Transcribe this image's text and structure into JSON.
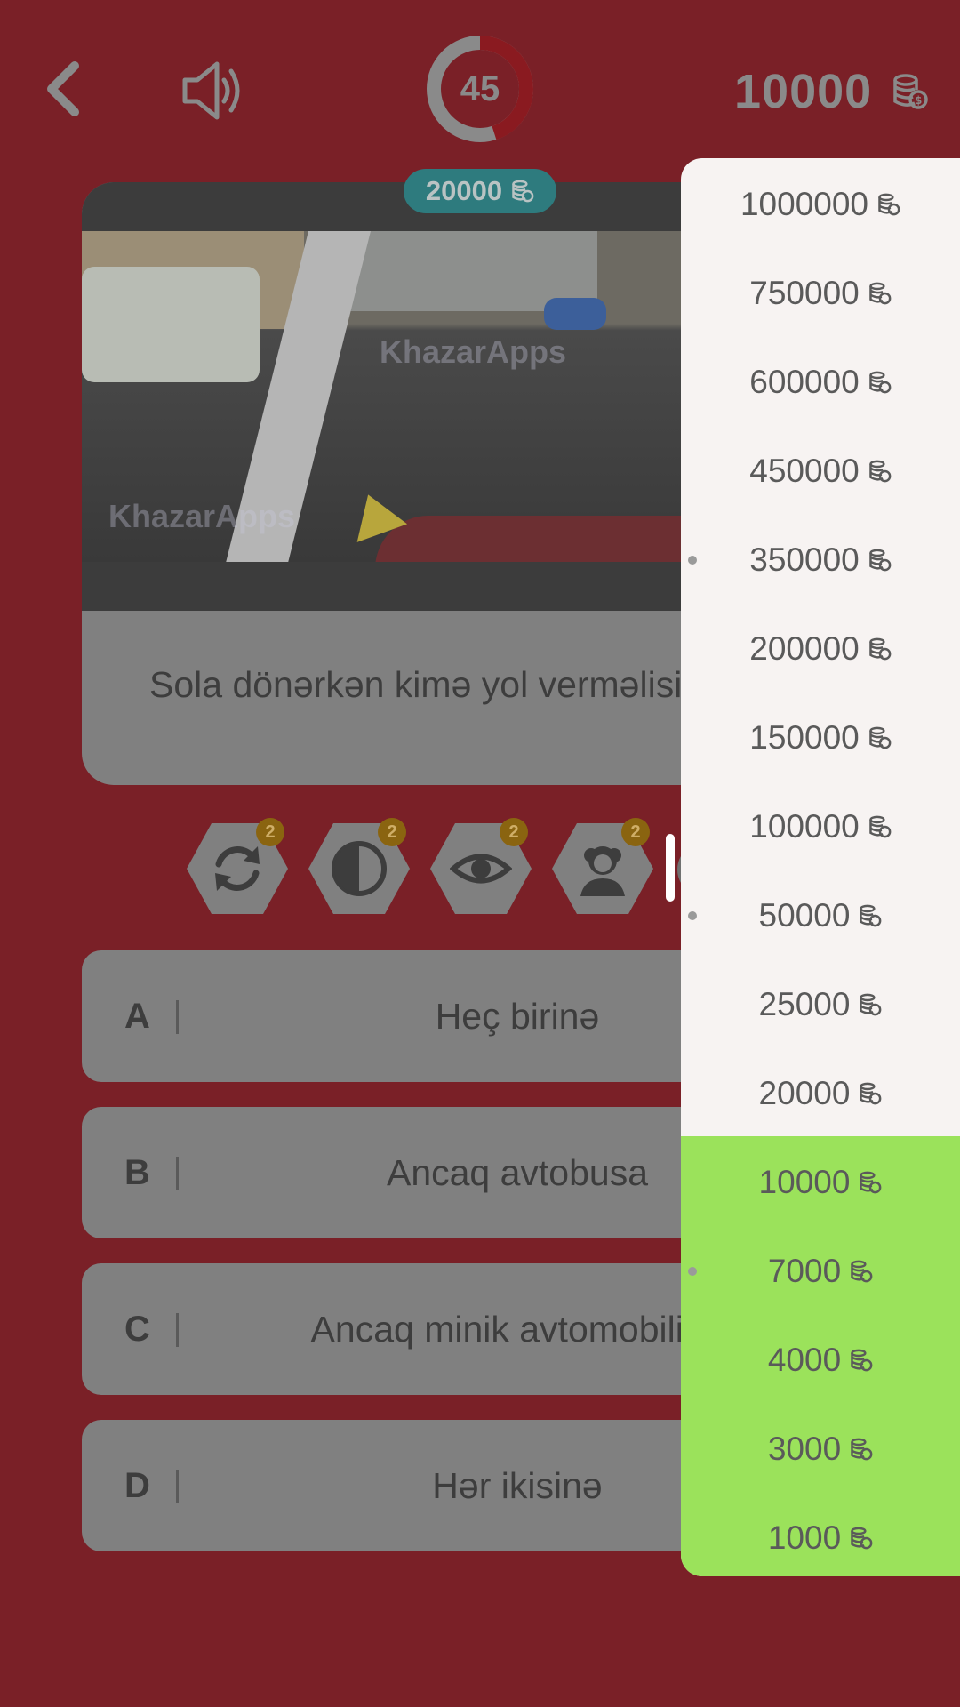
{
  "header": {
    "timer_value": "45",
    "timer_progress": 0.45,
    "balance": "10000",
    "icons": [
      "back-arrow-icon",
      "speaker-icon",
      "coins-icon"
    ]
  },
  "question": {
    "reward": "20000",
    "text": "Sola dönərkən kimə yol verməlisiniz?",
    "watermark": "KhazarApps"
  },
  "lifelines": [
    {
      "name": "swap-question",
      "icon": "refresh-icon",
      "count": "2"
    },
    {
      "name": "fifty-fifty",
      "icon": "half-circle-icon",
      "count": "2"
    },
    {
      "name": "audience",
      "icon": "eye-icon",
      "count": "2"
    },
    {
      "name": "expert",
      "icon": "professor-icon",
      "count": "2"
    }
  ],
  "answers": [
    {
      "letter": "A",
      "text": "Heç birinə"
    },
    {
      "letter": "B",
      "text": "Ancaq avtobusa"
    },
    {
      "letter": "C",
      "text": "Ancaq minik avtomobilinə"
    },
    {
      "letter": "D",
      "text": "Hər ikisinə"
    }
  ],
  "ladder": {
    "levels": [
      {
        "amount": "1000000",
        "milestone": false,
        "reached": false
      },
      {
        "amount": "750000",
        "milestone": false,
        "reached": false
      },
      {
        "amount": "600000",
        "milestone": false,
        "reached": false
      },
      {
        "amount": "450000",
        "milestone": false,
        "reached": false
      },
      {
        "amount": "350000",
        "milestone": true,
        "reached": false
      },
      {
        "amount": "200000",
        "milestone": false,
        "reached": false
      },
      {
        "amount": "150000",
        "milestone": false,
        "reached": false
      },
      {
        "amount": "100000",
        "milestone": false,
        "reached": false
      },
      {
        "amount": "50000",
        "milestone": true,
        "reached": false
      },
      {
        "amount": "25000",
        "milestone": false,
        "reached": false
      },
      {
        "amount": "20000",
        "milestone": false,
        "reached": false
      },
      {
        "amount": "10000",
        "milestone": false,
        "reached": true
      },
      {
        "amount": "7000",
        "milestone": true,
        "reached": true
      },
      {
        "amount": "4000",
        "milestone": false,
        "reached": true
      },
      {
        "amount": "3000",
        "milestone": false,
        "reached": true
      },
      {
        "amount": "1000",
        "milestone": false,
        "reached": true
      }
    ],
    "colors": {
      "panel": "#f7f3f2",
      "reached": "#9be25b"
    }
  },
  "colors": {
    "background": "#7a2027",
    "card": "#808080",
    "timer_active": "#8a1a20",
    "badge": "#2e7b7e",
    "lifeline_count": "#8a6410"
  }
}
